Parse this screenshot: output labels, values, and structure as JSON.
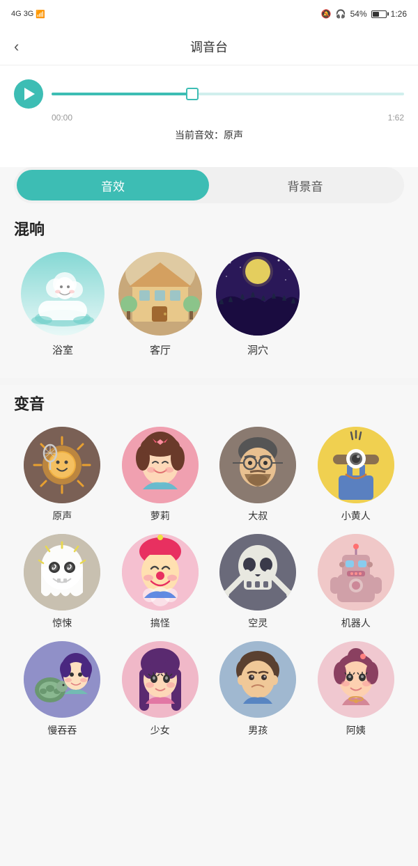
{
  "statusBar": {
    "signal": "4G",
    "time": "1:26",
    "battery": "54%",
    "icons": [
      "bell-off-icon",
      "headphone-icon"
    ]
  },
  "header": {
    "title": "调音台",
    "backLabel": "<"
  },
  "player": {
    "currentTime": "00:00",
    "totalTime": "1:62",
    "progressPercent": 40,
    "currentEffect": "当前音效：原声"
  },
  "tabs": {
    "active": "音效",
    "items": [
      "音效",
      "背景音"
    ]
  },
  "reverb": {
    "sectionTitle": "混响",
    "items": [
      {
        "label": "浴室",
        "type": "bathroom"
      },
      {
        "label": "客厅",
        "type": "living"
      },
      {
        "label": "洞穴",
        "type": "cave"
      }
    ]
  },
  "voice": {
    "sectionTitle": "变音",
    "items": [
      {
        "label": "原声",
        "type": "original"
      },
      {
        "label": "萝莉",
        "type": "loli"
      },
      {
        "label": "大叔",
        "type": "uncle"
      },
      {
        "label": "小黄人",
        "type": "minion"
      },
      {
        "label": "惊悚",
        "type": "horror"
      },
      {
        "label": "搞怪",
        "type": "funny"
      },
      {
        "label": "空灵",
        "type": "ethereal"
      },
      {
        "label": "机器人",
        "type": "robot"
      },
      {
        "label": "慢吞吞",
        "type": "slow"
      },
      {
        "label": "少女",
        "type": "girl"
      },
      {
        "label": "男孩",
        "type": "boy"
      },
      {
        "label": "阿姨",
        "type": "auntie"
      }
    ]
  }
}
